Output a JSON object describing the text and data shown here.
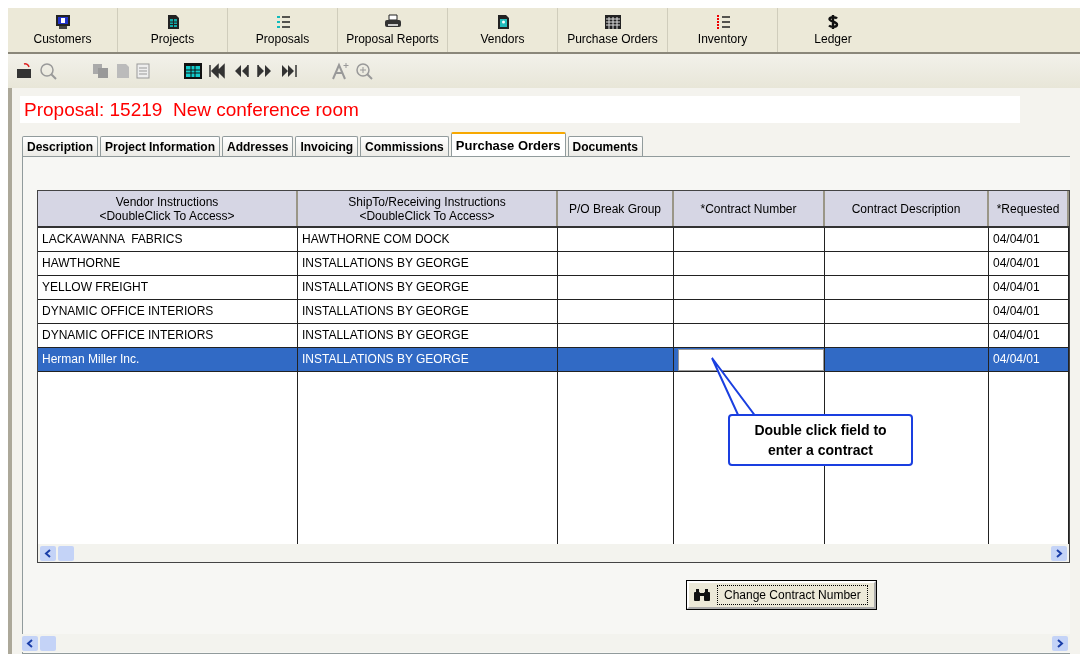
{
  "nav": [
    {
      "label": "Customers",
      "kind": "monitor"
    },
    {
      "label": "Projects",
      "kind": "doc"
    },
    {
      "label": "Proposals",
      "kind": "list"
    },
    {
      "label": "Proposal Reports",
      "kind": "printer"
    },
    {
      "label": "Vendors",
      "kind": "badge"
    },
    {
      "label": "Purchase Orders",
      "kind": "grid"
    },
    {
      "label": "Inventory",
      "kind": "numlist"
    },
    {
      "label": "Ledger",
      "kind": "dollar"
    }
  ],
  "title": "Proposal: 15219  New conference room",
  "tabs": [
    {
      "label": "Description",
      "selected": false
    },
    {
      "label": "Project Information",
      "selected": false
    },
    {
      "label": "Addresses",
      "selected": false
    },
    {
      "label": "Invoicing",
      "selected": false
    },
    {
      "label": "Commissions",
      "selected": false
    },
    {
      "label": "Purchase Orders",
      "selected": true
    },
    {
      "label": "Documents",
      "selected": false
    }
  ],
  "table": {
    "columns": [
      "Vendor Instructions\n<DoubleClick To Access>",
      "ShipTo/Receiving Instructions\n<DoubleClick To Access>",
      "P/O Break Group",
      "*Contract Number",
      "Contract Description",
      "*Requested"
    ],
    "rows": [
      {
        "cells": [
          "LACKAWANNA  FABRICS",
          "HAWTHORNE COM DOCK",
          "",
          "",
          "",
          "04/04/01"
        ],
        "selected": false
      },
      {
        "cells": [
          "HAWTHORNE",
          "INSTALLATIONS BY GEORGE",
          "",
          "",
          "",
          "04/04/01"
        ],
        "selected": false
      },
      {
        "cells": [
          "YELLOW FREIGHT",
          "INSTALLATIONS BY GEORGE",
          "",
          "",
          "",
          "04/04/01"
        ],
        "selected": false
      },
      {
        "cells": [
          "DYNAMIC OFFICE INTERIORS",
          "INSTALLATIONS BY GEORGE",
          "",
          "",
          "",
          "04/04/01"
        ],
        "selected": false
      },
      {
        "cells": [
          "DYNAMIC OFFICE INTERIORS",
          "INSTALLATIONS BY GEORGE",
          "",
          "",
          "",
          "04/04/01"
        ],
        "selected": false
      },
      {
        "cells": [
          "Herman Miller Inc.",
          "INSTALLATIONS BY GEORGE",
          "",
          "",
          "",
          "04/04/01"
        ],
        "selected": true
      }
    ]
  },
  "callout": "Double click field to enter a contract",
  "button": "Change Contract Number"
}
